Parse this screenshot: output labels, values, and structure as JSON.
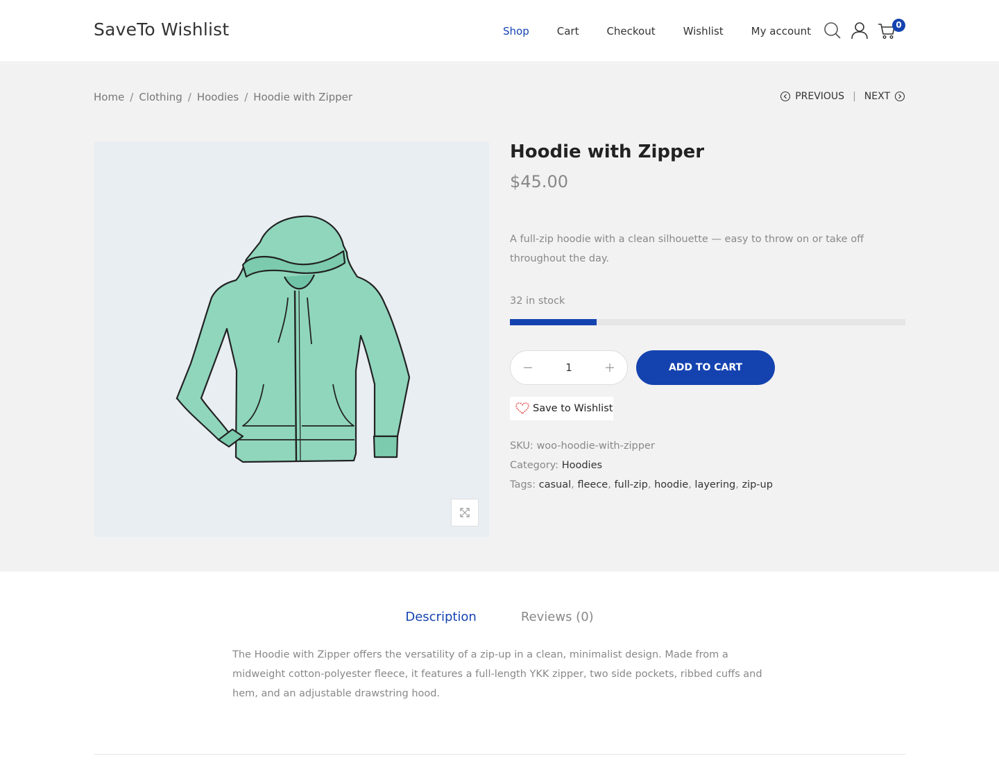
{
  "header": {
    "brand": "SaveTo Wishlist",
    "nav": [
      {
        "label": "Shop",
        "active": true
      },
      {
        "label": "Cart",
        "active": false
      },
      {
        "label": "Checkout",
        "active": false
      },
      {
        "label": "Wishlist",
        "active": false
      },
      {
        "label": "My account",
        "active": false
      }
    ],
    "cart_count": "0",
    "icons": [
      "search-icon",
      "user-icon",
      "cart-icon"
    ]
  },
  "breadcrumb": {
    "items": [
      "Home",
      "Clothing",
      "Hoodies",
      "Hoodie with Zipper"
    ],
    "separator": "/"
  },
  "pager": {
    "previous": "PREVIOUS",
    "separator": "|",
    "next": "NEXT"
  },
  "product": {
    "title": "Hoodie with Zipper",
    "price": "$45.00",
    "short_description": "A full-zip hoodie with a clean silhouette — easy to throw on or take off throughout the day.",
    "stock_text": "32 in stock",
    "stock_level": 0.22,
    "quantity": "1",
    "add_to_cart": "ADD TO CART",
    "wishlist_label": "Save to Wishlist",
    "sku_label": "SKU:",
    "sku": "woo-hoodie-with-zipper",
    "category_label": "Category:",
    "category": "Hoodies",
    "tags_label": "Tags:",
    "tags": [
      "casual",
      "fleece",
      "full-zip",
      "hoodie",
      "layering",
      "zip-up"
    ]
  },
  "tabs": [
    {
      "label": "Description",
      "active": true
    },
    {
      "label": "Reviews (0)",
      "active": false
    }
  ],
  "description": "The Hoodie with Zipper offers the versatility of a zip-up in a clean, minimalist design. Made from a midweight cotton-polyester fleece, it features a full-length YKK zipper, two side pockets, ribbed cuffs and hem, and an adjustable drawstring hood.",
  "colors": {
    "accent": "#1443b0",
    "gray_bg": "#f2f2f2",
    "image_bg": "#e9eef3",
    "hoodie": "#8fd6bd"
  }
}
